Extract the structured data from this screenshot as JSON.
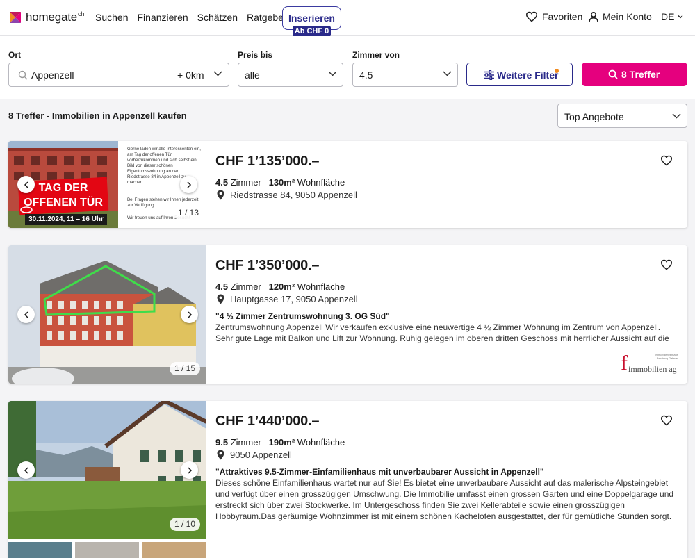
{
  "header": {
    "logo_text": "homegate",
    "logo_sup": "ch",
    "nav": [
      "Suchen",
      "Finanzieren",
      "Schätzen",
      "Ratgeber"
    ],
    "insert_label": "Inserieren",
    "insert_badge": "Ab CHF 0",
    "favorites": "Favoriten",
    "account": "Mein Konto",
    "language": "DE"
  },
  "filters": {
    "location_label": "Ort",
    "location_value": "Appenzell",
    "radius": "+ 0km",
    "price_label": "Preis bis",
    "price_value": "alle",
    "rooms_label": "Zimmer von",
    "rooms_value": "4.5",
    "more_filters": "Weitere Filter",
    "search_button": "8 Treffer"
  },
  "results": {
    "title": "8 Treffer - Immobilien in Appenzell kaufen",
    "sort": "Top Angebote"
  },
  "listings": [
    {
      "price": "CHF 1’135’000.–",
      "rooms": "4.5",
      "rooms_label": "Zimmer",
      "area": "130m²",
      "area_label": "Wohnfläche",
      "address": "Riedstrasse 84, 9050 Appenzell",
      "image_counter": "1 / 13",
      "banner_line1": "TAG DER",
      "banner_line2": "OFFENEN TÜR",
      "banner_date": "30.11.2024, 11 – 16 Uhr",
      "invite_p1": "Gerne laden wir alle Interessenten ein, am Tag der offenen Tür vorbeizukommen und sich selbst ein Bild von dieser schönen Eigentumswohnung an der Riedstrasse 84 in Appenzell zu machen.",
      "invite_p2": "Bei Fragen stehen wir Ihnen jederzeit zur Verfügung.",
      "invite_p3": "Wir freuen uns auf Ihren Besuch!"
    },
    {
      "price": "CHF 1’350’000.–",
      "rooms": "4.5",
      "rooms_label": "Zimmer",
      "area": "120m²",
      "area_label": "Wohnfläche",
      "address": "Hauptgasse 17, 9050 Appenzell",
      "title": "\"4 ½ Zimmer Zentrumswohnung 3. OG Süd\"",
      "description": "Zentrumswohnung Appenzell Wir verkaufen exklusive eine neuwertige 4 ½ Zimmer Wohnung im Zentrum von Appenzell. Sehr gute Lage mit Balkon und Lift zur Wohnung. Ruhig gelegen im oberen dritten Geschoss mit herrlicher Aussicht auf die Berge und …",
      "image_counter": "1 / 15",
      "agency_letter": "f",
      "agency_name": "immobilien ag",
      "agency_tagline": "Immobilienverkauf Beratung Galerie"
    },
    {
      "price": "CHF 1’440’000.–",
      "rooms": "9.5",
      "rooms_label": "Zimmer",
      "area": "190m²",
      "area_label": "Wohnfläche",
      "address": "9050 Appenzell",
      "title": "\"Attraktives 9.5-Zimmer-Einfamilienhaus mit unverbaubarer Aussicht in Appenzell\"",
      "description": "Dieses schöne Einfamilienhaus wartet nur auf Sie! Es bietet eine unverbaubare Aussicht auf das malerische Alpsteingebiet und verfügt über einen grosszügigen Umschwung. Die Immobilie umfasst einen grossen Garten und eine Doppelgarage und erstreckt sich über zwei Stockwerke. Im Untergeschoss finden Sie zwei Kellerabteile sowie einen grosszügigen Hobbyraum.Das geräumige Wohnzimmer ist mit einem schönen Kachelofen ausgestattet, der für gemütliche Stunden sorgt. Im Erdgeschoss und…",
      "image_counter": "1 / 10"
    }
  ],
  "colors": {
    "brand_pink": "#e5007e",
    "brand_navy": "#2a2a8a",
    "filter_dot": "#f08a1e"
  }
}
